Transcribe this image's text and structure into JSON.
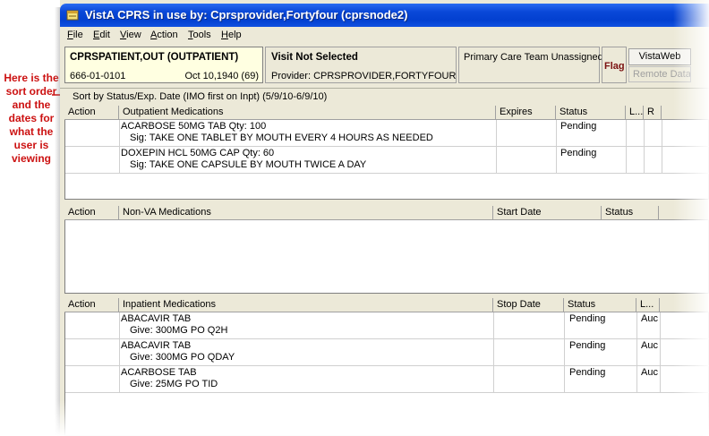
{
  "annotation": {
    "text": "Here is the sort order and the dates for what the user is viewing"
  },
  "window": {
    "title": "VistA CPRS in use by: Cprsprovider,Fortyfour  (cprsnode2)"
  },
  "menu": {
    "items": [
      {
        "label": "File",
        "accel": "F",
        "rest": "ile"
      },
      {
        "label": "Edit",
        "accel": "E",
        "rest": "dit"
      },
      {
        "label": "View",
        "accel": "V",
        "rest": "iew"
      },
      {
        "label": "Action",
        "accel": "A",
        "rest": "ction"
      },
      {
        "label": "Tools",
        "accel": "T",
        "rest": "ools"
      },
      {
        "label": "Help",
        "accel": "H",
        "rest": "elp"
      }
    ]
  },
  "patient": {
    "name": "CPRSPATIENT,OUT (OUTPATIENT)",
    "ssn": "666-01-0101",
    "dob": "Oct 10,1940 (69)"
  },
  "visit": {
    "title": "Visit Not Selected",
    "provider": "Provider:  CPRSPROVIDER,FORTYFOUR"
  },
  "pc_team": "Primary Care Team Unassigned",
  "flag_label": "Flag",
  "vistaweb_label": "VistaWeb",
  "remote_data_label": "Remote Data",
  "sort_text": "Sort by Status/Exp. Date (IMO first on Inpt)  (5/9/10-6/9/10)",
  "outpatient": {
    "headers": [
      "Action",
      "Outpatient Medications",
      "Expires",
      "Status",
      "L...",
      "R"
    ],
    "rows": [
      {
        "drug": "ACARBOSE 50MG TAB  Qty: 100",
        "sig": "Sig: TAKE ONE TABLET BY MOUTH EVERY 4 HOURS AS NEEDED",
        "status": "Pending"
      },
      {
        "drug": "DOXEPIN HCL 50MG CAP  Qty: 60",
        "sig": "Sig: TAKE ONE CAPSULE BY MOUTH TWICE A DAY",
        "status": "Pending"
      }
    ]
  },
  "nonva": {
    "headers": [
      "Action",
      "Non-VA Medications",
      "Start Date",
      "Status"
    ]
  },
  "inpatient": {
    "headers": [
      "Action",
      "Inpatient Medications",
      "Stop Date",
      "Status",
      "L..."
    ],
    "rows": [
      {
        "drug": "ABACAVIR TAB",
        "sig": "Give: 300MG PO Q2H",
        "status": "Pending",
        "loc": "Auc"
      },
      {
        "drug": "ABACAVIR TAB",
        "sig": "Give: 300MG PO QDAY",
        "status": "Pending",
        "loc": "Auc"
      },
      {
        "drug": "ACARBOSE TAB",
        "sig": "Give: 25MG PO TID",
        "status": "Pending",
        "loc": "Auc"
      }
    ]
  },
  "colors": {
    "annotation": "#cc1111",
    "titlebar": "#0a48d8",
    "patient_bg": "#ffffe1",
    "flag": "#7a1010"
  }
}
